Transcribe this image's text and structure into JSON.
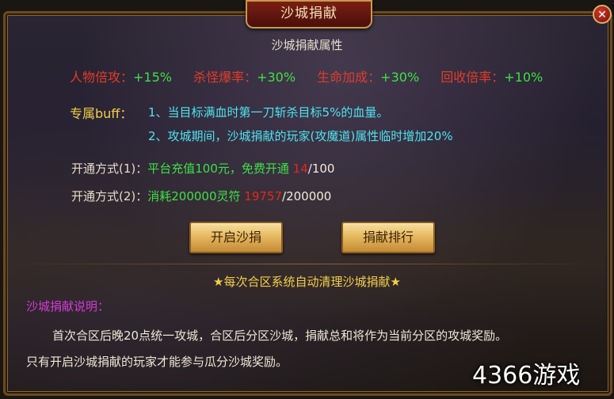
{
  "window": {
    "title": "沙城捐献",
    "close_label": "✕"
  },
  "section_title": "沙城捐献属性",
  "attributes": [
    {
      "label": "人物倍攻：",
      "value": "+15%"
    },
    {
      "label": "杀怪爆率：",
      "value": "+30%"
    },
    {
      "label": "生命加成：",
      "value": "+30%"
    },
    {
      "label": "回收倍率：",
      "value": "+10%"
    }
  ],
  "buff": {
    "label": "专属buff：",
    "lines": [
      "1、当目标满血时第一刀斩杀目标5%的血量。",
      "2、攻城期间，沙城捐献的玩家(攻魔道)属性临时增加20%"
    ]
  },
  "open_methods": [
    {
      "label": "开通方式(1)：",
      "desc": "平台充值100元，免费开通",
      "current": "14",
      "total": "/100"
    },
    {
      "label": "开通方式(2)：",
      "desc": "消耗200000灵符",
      "current": "19757",
      "total": "/200000"
    }
  ],
  "buttons": {
    "open": "开启沙捐",
    "ranking": "捐献排行"
  },
  "notice": "★每次合区系统自动清理沙城捐献★",
  "explanation": {
    "title": "沙城捐献说明：",
    "line1": "首次合区后晚20点统一攻城，合区后分区沙城，捐献总和将作为当前分区的攻城奖励。",
    "line2": "只有开启沙城捐献的玩家才能参与瓜分沙城奖励。"
  },
  "watermark": "4366游戏",
  "colors": {
    "red": "#e33b2b",
    "green": "#3ee045",
    "cyan": "#4ee3ee",
    "yellow": "#f2cf48",
    "magenta": "#d43ad8"
  }
}
